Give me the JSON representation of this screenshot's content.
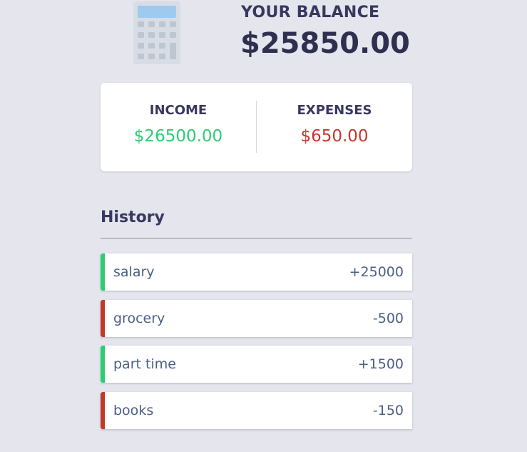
{
  "colors": {
    "background": "#e5e5ee",
    "income": "#2ecc71",
    "expense": "#c0392b",
    "text_dark": "#38385f"
  },
  "header": {
    "icon": "calculator-icon",
    "balance_label": "YOUR BALANCE",
    "balance_value": "$25850.00"
  },
  "summary": {
    "income_label": "INCOME",
    "income_value": "$26500.00",
    "expense_label": "EXPENSES",
    "expense_value": "$650.00"
  },
  "history": {
    "title": "History",
    "items": [
      {
        "text": "salary",
        "amount": "+25000",
        "type": "income"
      },
      {
        "text": "grocery",
        "amount": "-500",
        "type": "expense"
      },
      {
        "text": "part time",
        "amount": "+1500",
        "type": "income"
      },
      {
        "text": "books",
        "amount": "-150",
        "type": "expense"
      }
    ]
  }
}
